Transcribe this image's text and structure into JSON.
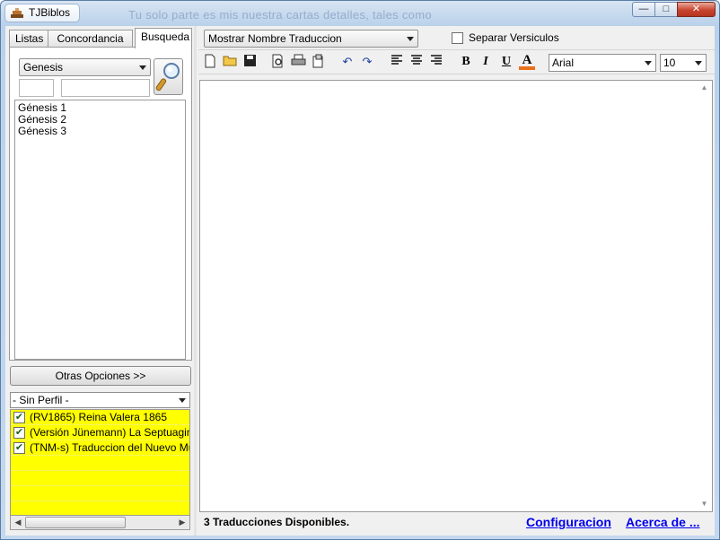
{
  "window": {
    "title": "TJBiblos",
    "ghost_title": "Tu solo parte es mis nuestra cartas detalles, tales como"
  },
  "left_tabs": [
    {
      "label": "Listas"
    },
    {
      "label": "Concordancia"
    },
    {
      "label": "Busqueda",
      "active": true
    }
  ],
  "book_combo": {
    "value": "Genesis"
  },
  "chapter_list": [
    "Génesis 1",
    "Génesis 2",
    "Génesis 3"
  ],
  "more_options_button": {
    "label": "Otras Opciones >>"
  },
  "profile_combo": {
    "value": "- Sin Perfil -"
  },
  "translations": [
    {
      "label": "(RV1865) Reina Valera 1865",
      "checked": true
    },
    {
      "label": "(Versión Jünemann) La Septuaginta",
      "checked": true
    },
    {
      "label": "(TNM-s) Traduccion del Nuevo Mundo",
      "checked": true
    }
  ],
  "translation_display_combo": {
    "value": "Mostrar Nombre Traduccion"
  },
  "separate_verses": {
    "label": "Separar Versiculos",
    "checked": false
  },
  "font_combo": {
    "value": "Arial"
  },
  "size_combo": {
    "value": "10"
  },
  "format_labels": {
    "bold": "B",
    "italic": "I",
    "underline": "U",
    "color": "A"
  },
  "status_text": "3 Traducciones Disponibles.",
  "links": {
    "config": "Configuracion",
    "about": "Acerca de ..."
  },
  "colors": {
    "checklist_bg": "#ffff00",
    "link": "#0000ee",
    "close_button": "#c8452f"
  },
  "icons": {
    "app": "app-icon",
    "minimize": "minimize-icon",
    "maximize": "maximize-icon",
    "close": "close-icon",
    "search": "magnifier-icon",
    "new": "new-document-icon",
    "open": "open-folder-icon",
    "save": "save-icon",
    "print_preview": "print-preview-icon",
    "print": "print-icon",
    "page_setup": "page-setup-icon",
    "undo": "undo-icon",
    "redo": "redo-icon",
    "align_left": "align-left-icon",
    "align_center": "align-center-icon",
    "align_right": "align-right-icon",
    "font_color": "font-color-icon"
  }
}
